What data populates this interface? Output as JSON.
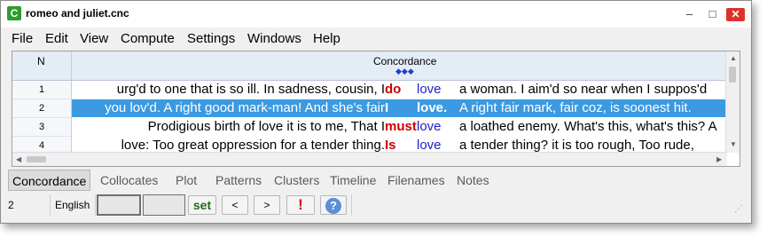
{
  "window": {
    "title": "romeo and juliet.cnc",
    "app_icon": "C"
  },
  "titlebar_buttons": {
    "minimize": "–",
    "maximize": "□",
    "close": "✕"
  },
  "menu": [
    "File",
    "Edit",
    "View",
    "Compute",
    "Settings",
    "Windows",
    "Help"
  ],
  "grid": {
    "columns": {
      "n": "N",
      "concordance": "Concordance",
      "sort_icon": "◆◆◆"
    },
    "rows": [
      {
        "n": "1",
        "left": "urg'd to one that is so ill. In sadness, cousin, I",
        "kw": "do",
        "node": "love",
        "right": "a woman. I aim'd so near when I suppos'd"
      },
      {
        "n": "2",
        "left": "you lov'd. A right good mark-man! And she's fair",
        "kw": "I",
        "node": "love.",
        "right": "A right fair mark, fair coz, is soonest hit."
      },
      {
        "n": "3",
        "left": "Prodigious birth of love it is to me, That I",
        "kw": "must",
        "node": "love",
        "right": "a loathed enemy. What's this, what's this? A"
      },
      {
        "n": "4",
        "left": "love: Too great oppression for a tender thing.",
        "kw": "Is",
        "node": "love",
        "right": "a tender thing? it is too rough, Too rude,"
      }
    ],
    "selected_row": 2,
    "accent_color": "#3b9ae1"
  },
  "tabs": [
    "Concordance",
    "Collocates",
    "Plot",
    "Patterns",
    "Clusters",
    "Timeline",
    "Filenames",
    "Notes"
  ],
  "status": {
    "count": "2",
    "language": "English",
    "set_label": "set",
    "prev_label": "<",
    "next_label": ">",
    "alert_label": "!",
    "help_label": "?"
  }
}
